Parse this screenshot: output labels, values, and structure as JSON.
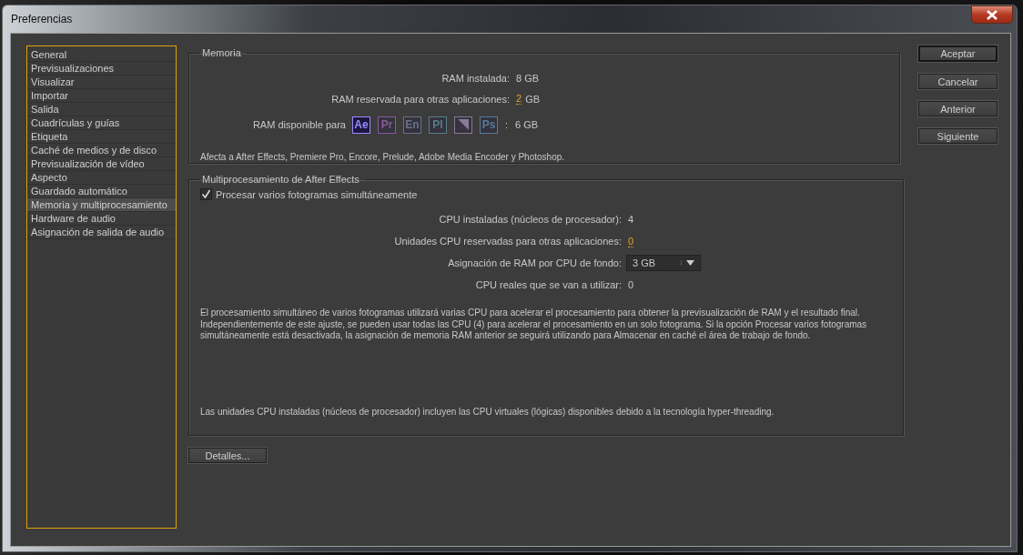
{
  "window": {
    "title": "Preferencias"
  },
  "sidebar": {
    "items": [
      {
        "label": "General",
        "selected": false
      },
      {
        "label": "Previsualizaciones",
        "selected": false
      },
      {
        "label": "Visualizar",
        "selected": false
      },
      {
        "label": "Importar",
        "selected": false
      },
      {
        "label": "Salida",
        "selected": false
      },
      {
        "label": "Cuadrículas y guías",
        "selected": false
      },
      {
        "label": "Etiqueta",
        "selected": false
      },
      {
        "label": "Caché de medios y de disco",
        "selected": false
      },
      {
        "label": "Previsualización de vídeo",
        "selected": false
      },
      {
        "label": "Aspecto",
        "selected": false
      },
      {
        "label": "Guardado automático",
        "selected": false
      },
      {
        "label": "Memoria y multiprocesamiento",
        "selected": true
      },
      {
        "label": "Hardware de audio",
        "selected": false
      },
      {
        "label": "Asignación de salida de audio",
        "selected": false
      }
    ]
  },
  "memory": {
    "title": "Memoria",
    "rows": [
      {
        "kind": "text",
        "label": "RAM instalada:",
        "value": "8 GB"
      },
      {
        "kind": "editable",
        "label": "RAM reservada para otras aplicaciones:",
        "value": "2",
        "unit": "GB"
      }
    ],
    "apps_label": "RAM disponible para",
    "apps": [
      {
        "kind": "text",
        "label": "Ae",
        "selected": true,
        "color": "#9a8cff"
      },
      {
        "kind": "text",
        "label": "Pr",
        "selected": false,
        "color": "#8a5a9a"
      },
      {
        "kind": "text",
        "label": "En",
        "selected": false,
        "color": "#6a7088"
      },
      {
        "kind": "text",
        "label": "Pl",
        "selected": false,
        "color": "#5a7c8c"
      },
      {
        "kind": "graphic",
        "selected": false,
        "color": "#8a7a9a"
      },
      {
        "kind": "text",
        "label": "Ps",
        "selected": false,
        "color": "#5a7a9a"
      }
    ],
    "apps_separator": ":",
    "apps_value": "6 GB",
    "note": "Afecta a After Effects, Premiere Pro, Encore, Prelude, Adobe Media Encoder y Photoshop."
  },
  "multiprocessing": {
    "title": "Multiprocesamiento de After Effects",
    "checkbox": {
      "label": "Procesar varios fotogramas simultáneamente",
      "checked": true
    },
    "rows": [
      {
        "kind": "text",
        "label": "CPU instaladas (núcleos de procesador):",
        "value": "4"
      },
      {
        "kind": "editable",
        "label": "Unidades CPU reservadas para otras aplicaciones:",
        "value": "0"
      },
      {
        "kind": "dropdown",
        "label": "Asignación de RAM por CPU de fondo:",
        "value": "3 GB"
      },
      {
        "kind": "text",
        "label": "CPU reales que se van a utilizar:",
        "value": "0"
      }
    ],
    "description": "El procesamiento simultáneo de varios fotogramas utilizará varias CPU para acelerar el procesamiento para obtener la previsualización de RAM y el resultado final. Independientemente de este ajuste, se pueden usar todas las CPU (4) para acelerar el procesamiento en un solo fotograma. Si la opción Procesar varios fotogramas simultáneamente está desactivada, la asignación de memoria RAM anterior se seguirá utilizando para Almacenar en caché el área de trabajo de fondo.",
    "footnote": "Las unidades CPU instaladas (núcleos de procesador) incluyen las CPU virtuales (lógicas) disponibles debido a la tecnología hyper-threading."
  },
  "details_button": "Detalles...",
  "buttons": [
    {
      "label": "Aceptar",
      "default": true
    },
    {
      "label": "Cancelar",
      "default": false
    },
    {
      "label": "Anterior",
      "default": false
    },
    {
      "label": "Siguiente",
      "default": false
    }
  ]
}
